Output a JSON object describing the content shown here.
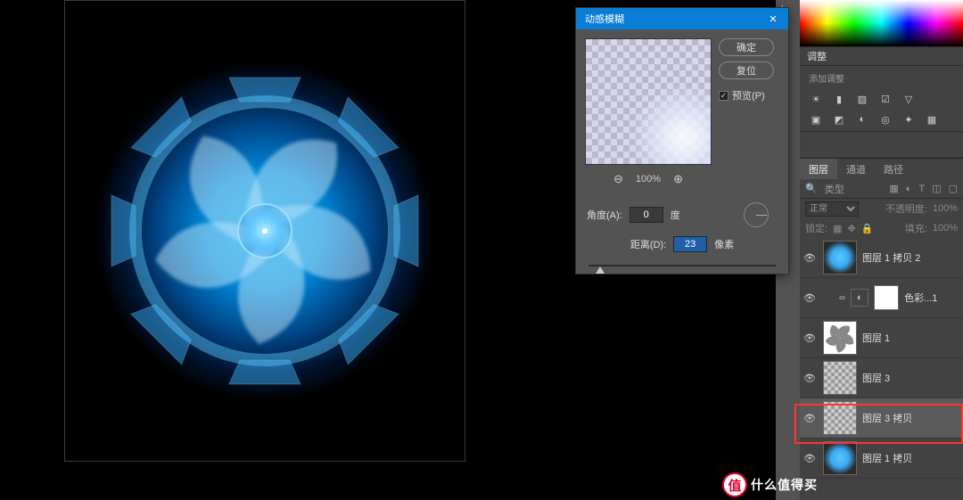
{
  "dialog": {
    "title": "动感模糊",
    "ok": "确定",
    "reset": "复位",
    "preview_check": "预览(P)",
    "zoom_label": "100%",
    "angle_label": "角度(A):",
    "angle_value": "0",
    "angle_unit": "度",
    "distance_label": "距离(D):",
    "distance_value": "23",
    "distance_unit": "像素"
  },
  "adjustments": {
    "title": "调整",
    "sub": "添加调整"
  },
  "layers": {
    "tabs": [
      "图层",
      "通道",
      "路径"
    ],
    "search_label": "类型",
    "blend": "正常",
    "opacity_label": "不透明度:",
    "opacity_value": "100%",
    "lock_label": "锁定:",
    "fill_label": "填充:",
    "fill_value": "100%",
    "items": [
      {
        "name": "图层 1 拷贝 2"
      },
      {
        "name": "色彩...1"
      },
      {
        "name": "图层 1"
      },
      {
        "name": "图层 3"
      },
      {
        "name": "图层 3 拷贝"
      },
      {
        "name": "图层 1 拷贝"
      }
    ]
  },
  "watermark": {
    "badge": "值",
    "text": "什么值得买"
  }
}
